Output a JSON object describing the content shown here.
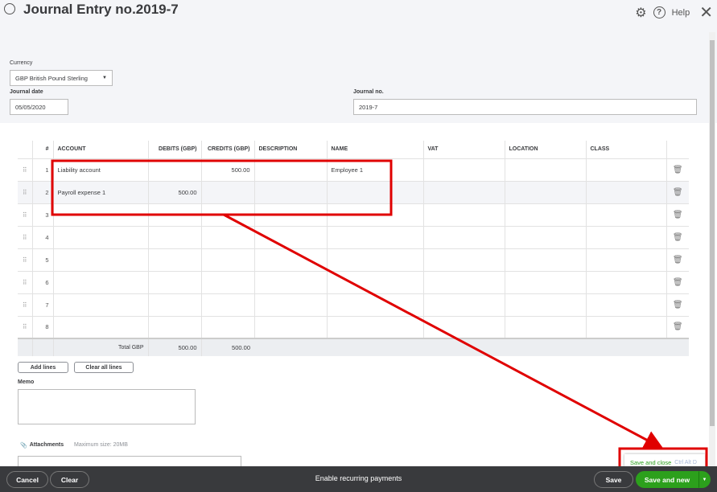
{
  "header": {
    "title": "Journal Entry no.2019-7",
    "help": "Help"
  },
  "form": {
    "currency_label": "Currency",
    "currency_value": "GBP British Pound Sterling",
    "date_label": "Journal date",
    "date_value": "05/05/2020",
    "journal_no_label": "Journal no.",
    "journal_no_value": "2019-7"
  },
  "table": {
    "columns": [
      "#",
      "ACCOUNT",
      "DEBITS (GBP)",
      "CREDITS (GBP)",
      "DESCRIPTION",
      "NAME",
      "VAT",
      "LOCATION",
      "CLASS"
    ],
    "rows": [
      {
        "n": "1",
        "account": "Liability account",
        "debit": "",
        "credit": "500.00",
        "description": "",
        "name": "Employee 1"
      },
      {
        "n": "2",
        "account": "Payroll expense 1",
        "debit": "500.00",
        "credit": "",
        "description": "",
        "name": ""
      },
      {
        "n": "3"
      },
      {
        "n": "4"
      },
      {
        "n": "5"
      },
      {
        "n": "6"
      },
      {
        "n": "7"
      },
      {
        "n": "8"
      }
    ],
    "total_label": "Total GBP",
    "total_debit": "500.00",
    "total_credit": "500.00"
  },
  "actions": {
    "add_lines": "Add lines",
    "clear_all": "Clear all lines",
    "memo_label": "Memo",
    "attachments_label": "Attachments",
    "max_size": "Maximum size: 20MB"
  },
  "dropdown": {
    "save_close": "Save and close",
    "shortcut": "Ctrl Alt D"
  },
  "footer": {
    "cancel": "Cancel",
    "clear": "Clear",
    "recurring": "Enable recurring payments",
    "save": "Save",
    "save_new": "Save and new"
  },
  "colors": {
    "green": "#2ca01c",
    "annotation": "#e00000"
  }
}
